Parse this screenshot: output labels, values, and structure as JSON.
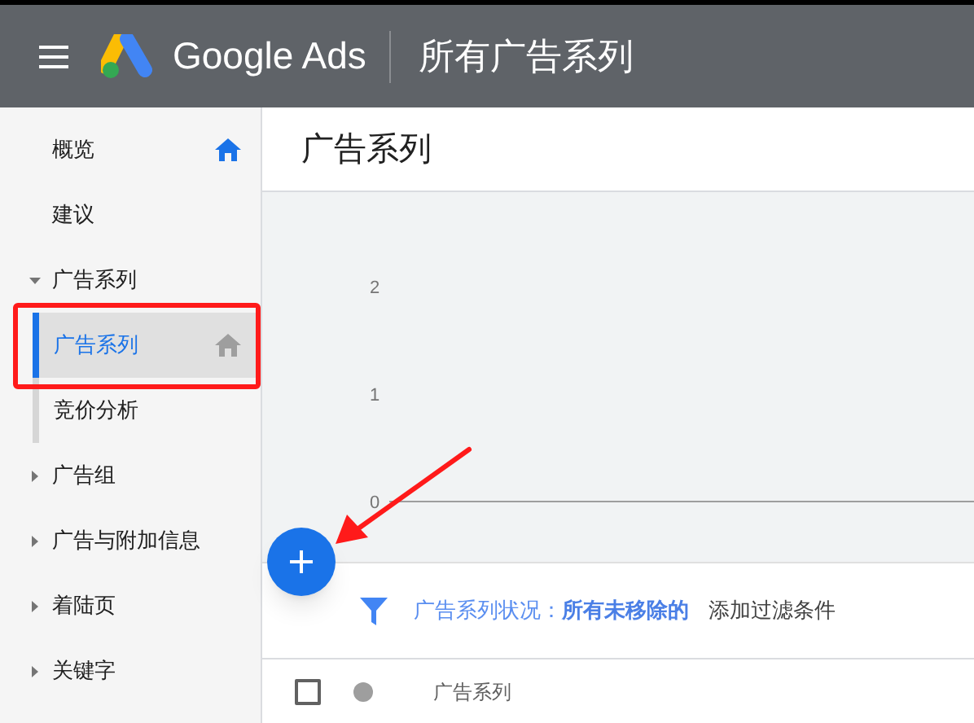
{
  "header": {
    "product": "Google Ads",
    "title": "所有广告系列"
  },
  "sidebar": {
    "items": [
      {
        "label": "概览",
        "selected": false,
        "home": true
      },
      {
        "label": "建议",
        "selected": false
      },
      {
        "label": "广告系列",
        "expanded": true,
        "children": [
          {
            "label": "广告系列",
            "selected": true,
            "home": false
          },
          {
            "label": "竞价分析",
            "selected": false
          }
        ]
      },
      {
        "label": "广告组",
        "expanded": false
      },
      {
        "label": "广告与附加信息",
        "expanded": false
      },
      {
        "label": "着陆页",
        "expanded": false
      },
      {
        "label": "关键字",
        "expanded": false
      }
    ]
  },
  "page": {
    "title": "广告系列"
  },
  "chart": {
    "axis_labels": [
      "2",
      "1",
      "0"
    ]
  },
  "filter": {
    "label": "广告系列状况：",
    "value": "所有未移除的",
    "add": "添加过滤条件"
  },
  "table": {
    "select_all": {
      "checked": false
    },
    "columns": [
      "广告系列"
    ]
  },
  "annotations": {
    "highlight_box": true,
    "arrow": true
  }
}
